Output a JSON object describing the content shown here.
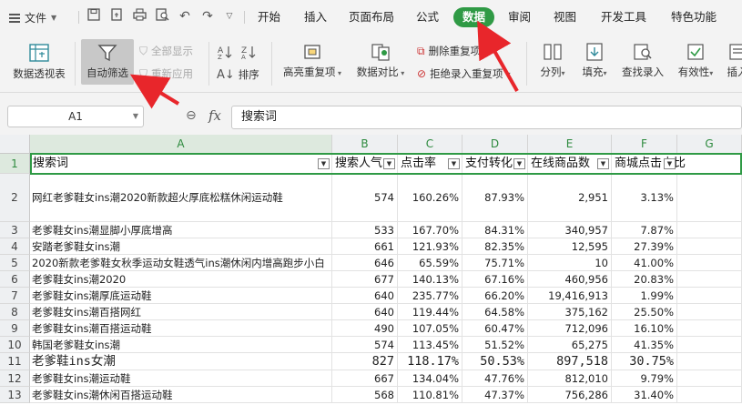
{
  "menu": {
    "file_label": "文件",
    "tabs": [
      "开始",
      "插入",
      "页面布局",
      "公式",
      "数据",
      "审阅",
      "视图",
      "开发工具",
      "特色功能"
    ],
    "active_tab": "数据"
  },
  "ribbon": {
    "pivot": "数据透视表",
    "autofilter": "自动筛选",
    "show_all": "全部显示",
    "reapply": "重新应用",
    "sort": "排序",
    "highlight_dup": "高亮重复项",
    "data_compare": "数据对比",
    "delete_dup": "删除重复项",
    "reject_dup": "拒绝录入重复项",
    "split": "分列",
    "fill": "填充",
    "find_entry": "查找录入",
    "validity": "有效性",
    "insert_more": "插入"
  },
  "formula_bar": {
    "name_box": "A1",
    "fx": "fx",
    "content": "搜索词"
  },
  "columns": [
    "A",
    "B",
    "C",
    "D",
    "E",
    "F",
    "G"
  ],
  "header_row": {
    "row_num": "1",
    "cells": [
      "搜索词",
      "搜索人气",
      "点击率",
      "支付转化",
      "在线商品数",
      "商城点击占比"
    ]
  },
  "rows": [
    {
      "n": "2",
      "a": "网红老爹鞋女ins潮2020新款超火厚底松糕休闲运动鞋",
      "b": "574",
      "c": "160.26%",
      "d": "87.93%",
      "e": "2,951",
      "f": "3.13%"
    },
    {
      "n": "3",
      "a": "老爹鞋女ins潮显脚小厚底增高",
      "b": "533",
      "c": "167.70%",
      "d": "84.31%",
      "e": "340,957",
      "f": "7.87%"
    },
    {
      "n": "4",
      "a": "安踏老爹鞋女ins潮",
      "b": "661",
      "c": "121.93%",
      "d": "82.35%",
      "e": "12,595",
      "f": "27.39%"
    },
    {
      "n": "5",
      "a": "2020新款老爹鞋女秋季运动女鞋透气ins潮休闲内增高跑步小白",
      "b": "646",
      "c": "65.59%",
      "d": "75.71%",
      "e": "10",
      "f": "41.00%"
    },
    {
      "n": "6",
      "a": "老爹鞋女ins潮2020",
      "b": "677",
      "c": "140.13%",
      "d": "67.16%",
      "e": "460,956",
      "f": "20.83%"
    },
    {
      "n": "7",
      "a": "老爹鞋女ins潮厚底运动鞋",
      "b": "640",
      "c": "235.77%",
      "d": "66.20%",
      "e": "19,416,913",
      "f": "1.99%"
    },
    {
      "n": "8",
      "a": "老爹鞋女ins潮百搭网红",
      "b": "640",
      "c": "119.44%",
      "d": "64.58%",
      "e": "375,162",
      "f": "25.50%"
    },
    {
      "n": "9",
      "a": "老爹鞋女ins潮百搭运动鞋",
      "b": "490",
      "c": "107.05%",
      "d": "60.47%",
      "e": "712,096",
      "f": "16.10%"
    },
    {
      "n": "10",
      "a": "韩国老爹鞋女ins潮",
      "b": "574",
      "c": "113.45%",
      "d": "51.52%",
      "e": "65,275",
      "f": "41.35%"
    },
    {
      "n": "11",
      "a": "老爹鞋ins女潮",
      "b": "827",
      "c": "118.17%",
      "d": "50.53%",
      "e": "897,518",
      "f": "30.75%"
    },
    {
      "n": "12",
      "a": "老爹鞋女ins潮运动鞋",
      "b": "667",
      "c": "134.04%",
      "d": "47.76%",
      "e": "812,010",
      "f": "9.79%"
    },
    {
      "n": "13",
      "a": "老爹鞋女ins潮休闲百搭运动鞋",
      "b": "568",
      "c": "110.81%",
      "d": "47.37%",
      "e": "756,286",
      "f": "31.40%"
    }
  ]
}
